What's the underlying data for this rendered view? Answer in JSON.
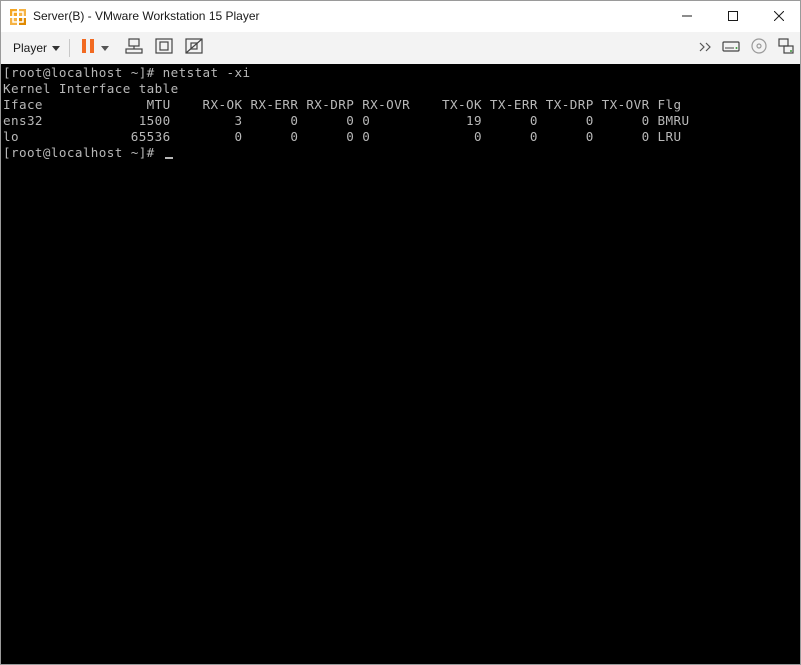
{
  "window": {
    "title": "Server(B) - VMware Workstation 15 Player",
    "icon": "vmware-player-icon",
    "controls": [
      "minimize-icon",
      "maximize-icon",
      "close-icon"
    ]
  },
  "toolbar": {
    "player_label": "Player",
    "icons": [
      "pause-icon",
      "dropdown-icon",
      "send-ctrl-alt-del-icon",
      "fit-window-icon",
      "unity-icon",
      "forward-icon",
      "hard-disk-icon",
      "cd-icon",
      "network-icon"
    ],
    "pause_color": "#f26a21"
  },
  "console": {
    "lines": [
      "[root@localhost ~]# netstat -xi",
      "Kernel Interface table",
      "Iface             MTU    RX-OK RX-ERR RX-DRP RX-OVR    TX-OK TX-ERR TX-DRP TX-OVR Flg",
      "ens32            1500        3      0      0 0            19      0      0      0 BMRU",
      "lo              65536        0      0      0 0             0      0      0      0 LRU",
      "[root@localhost ~]# "
    ]
  }
}
